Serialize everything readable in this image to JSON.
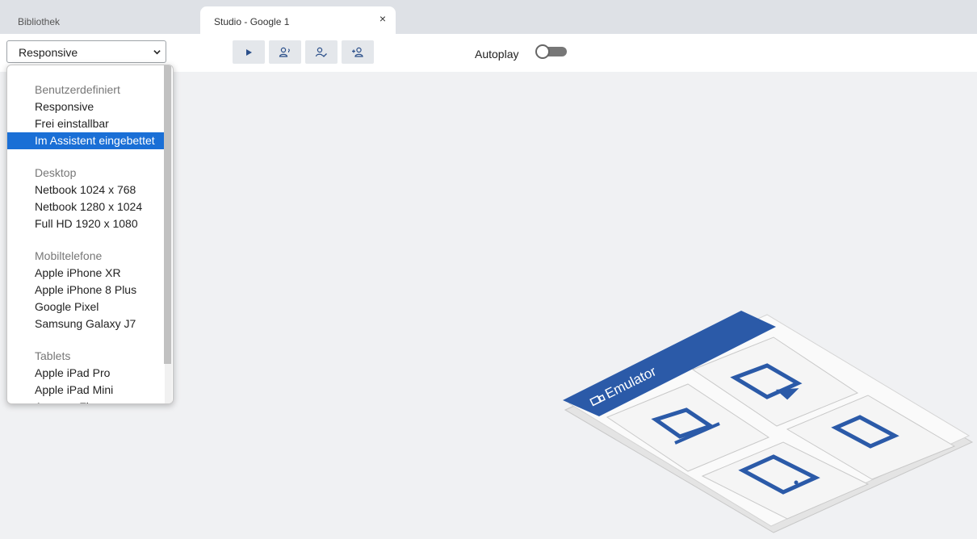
{
  "tabs": [
    {
      "label": "Bibliothek",
      "active": false
    },
    {
      "label": "Studio - Google 1",
      "active": true
    }
  ],
  "tab_close_icon": "×",
  "toolbar": {
    "device_select_value": "Responsive",
    "buttons": [
      {
        "name": "play",
        "icon": "play-icon"
      },
      {
        "name": "users",
        "icon": "users-icon"
      },
      {
        "name": "user-check",
        "icon": "user-check-icon"
      },
      {
        "name": "user-add",
        "icon": "user-add-icon"
      }
    ],
    "autoplay_label": "Autoplay",
    "autoplay_on": false
  },
  "dropdown": {
    "rows": [
      {
        "type": "group",
        "label": "Benutzerdefiniert"
      },
      {
        "type": "option",
        "label": "Responsive"
      },
      {
        "type": "option",
        "label": "Frei einstallbar"
      },
      {
        "type": "option",
        "label": "Im Assistent eingebettet",
        "selected": true
      },
      {
        "type": "spacer"
      },
      {
        "type": "group",
        "label": "Desktop"
      },
      {
        "type": "option",
        "label": "Netbook 1024 x 768"
      },
      {
        "type": "option",
        "label": "Netbook 1280 x 1024"
      },
      {
        "type": "option",
        "label": "Full HD 1920 x 1080"
      },
      {
        "type": "spacer"
      },
      {
        "type": "group",
        "label": "Mobiltelefone"
      },
      {
        "type": "option",
        "label": "Apple iPhone XR"
      },
      {
        "type": "option",
        "label": "Apple iPhone 8 Plus"
      },
      {
        "type": "option",
        "label": "Google Pixel"
      },
      {
        "type": "option",
        "label": "Samsung Galaxy J7"
      },
      {
        "type": "spacer"
      },
      {
        "type": "group",
        "label": "Tablets"
      },
      {
        "type": "option",
        "label": "Apple iPad Pro"
      },
      {
        "type": "option",
        "label": "Apple iPad Mini"
      },
      {
        "type": "option",
        "label": "Amazon Fire"
      }
    ]
  },
  "illustration": {
    "banner_text": "Emulator",
    "accent_color": "#2b5aa8"
  },
  "colors": {
    "selected_bg": "#1a6fd6",
    "canvas_bg": "#f0f1f3",
    "tabbar_bg": "#dee1e6"
  }
}
